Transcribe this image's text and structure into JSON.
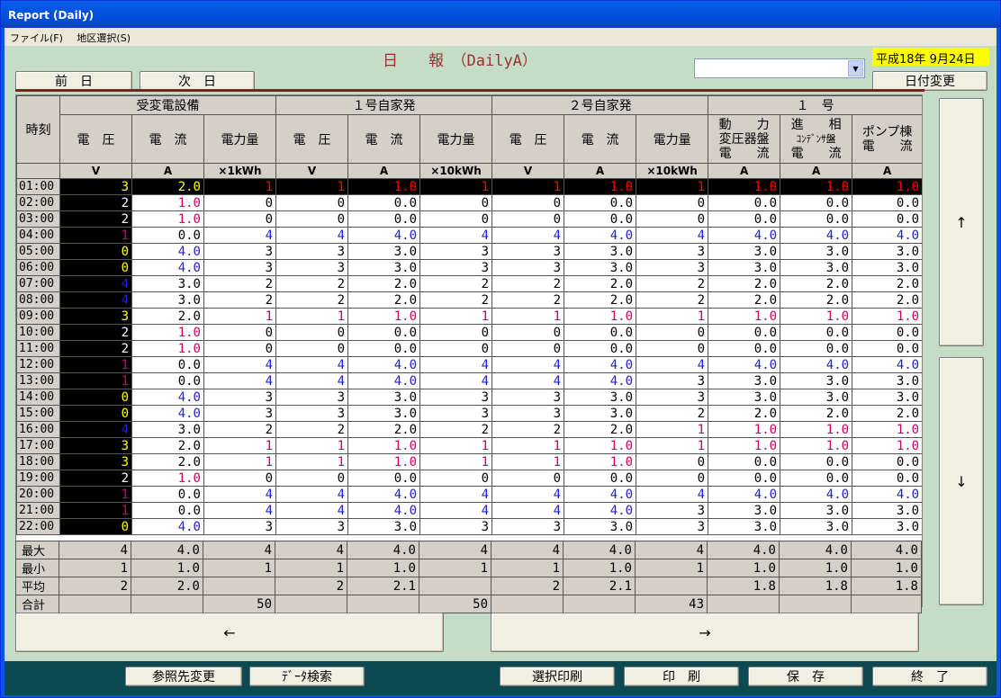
{
  "window": {
    "title": "Report (Daily)"
  },
  "menu": [
    "ファイル(F)",
    "地区選択(S)"
  ],
  "page_title": "日　　報　（DailyA）",
  "date_display": "平成18年 9月24日",
  "buttons": {
    "prev_day": "前　日",
    "next_day": "次　日",
    "change_date": "日付変更",
    "scroll_up": "↑",
    "scroll_down": "↓",
    "scroll_left": "←",
    "scroll_right": "→",
    "change_ref": "参照先変更",
    "data_search": "ﾃﾞｰﾀ検索",
    "select_print": "選択印刷",
    "print": "印　刷",
    "save": "保　存",
    "exit": "終　了"
  },
  "colors": {
    "yellow": "#ffff00",
    "magenta": "#cc0066",
    "blue": "#2222cc",
    "black": "#000000",
    "red": "#ff0000",
    "white": "#ffffff"
  },
  "table": {
    "time_header": "時刻",
    "groups": [
      "受変電設備",
      "１号自家発",
      "２号自家発",
      "１　号"
    ],
    "subheaders": [
      "電　圧",
      "電　流",
      "電力量",
      "電　圧",
      "電　流",
      "電力量",
      "電　圧",
      "電　流",
      "電力量"
    ],
    "extra_headers": [
      {
        "l1": "動　　力",
        "l2": "変圧器盤",
        "l3": "電　　流"
      },
      {
        "l1": "進　　相",
        "l2": "ｺﾝﾃﾞﾝｻ盤",
        "l3": "電　　流"
      },
      {
        "l1": "ポンプ棟",
        "l2": "",
        "l3": "電　　流"
      }
    ],
    "units": [
      "V",
      "A",
      "×1kWh",
      "V",
      "A",
      "×10kWh",
      "V",
      "A",
      "×10kWh",
      "A",
      "A",
      "A"
    ],
    "rows": [
      {
        "time": "01:00",
        "selected": true,
        "values": [
          "3",
          "2.0",
          "1",
          "1",
          "1.0",
          "1",
          "1",
          "1.0",
          "1",
          "1.0",
          "1.0",
          "1.0"
        ],
        "colors": [
          "yellow",
          "yellow",
          "red",
          "red",
          "red",
          "red",
          "red",
          "red",
          "red",
          "red",
          "red",
          "red"
        ]
      },
      {
        "time": "02:00",
        "values": [
          "2",
          "1.0",
          "0",
          "0",
          "0.0",
          "0",
          "0",
          "0.0",
          "0",
          "0.0",
          "0.0",
          "0.0"
        ],
        "colors": [
          "white",
          "magenta",
          "black",
          "black",
          "black",
          "black",
          "black",
          "black",
          "black",
          "black",
          "black",
          "black"
        ]
      },
      {
        "time": "03:00",
        "values": [
          "2",
          "1.0",
          "0",
          "0",
          "0.0",
          "0",
          "0",
          "0.0",
          "0",
          "0.0",
          "0.0",
          "0.0"
        ],
        "colors": [
          "white",
          "magenta",
          "black",
          "black",
          "black",
          "black",
          "black",
          "black",
          "black",
          "black",
          "black",
          "black"
        ]
      },
      {
        "time": "04:00",
        "values": [
          "1",
          "0.0",
          "4",
          "4",
          "4.0",
          "4",
          "4",
          "4.0",
          "4",
          "4.0",
          "4.0",
          "4.0"
        ],
        "colors": [
          "magenta",
          "black",
          "blue",
          "blue",
          "blue",
          "blue",
          "blue",
          "blue",
          "blue",
          "blue",
          "blue",
          "blue"
        ]
      },
      {
        "time": "05:00",
        "values": [
          "0",
          "4.0",
          "3",
          "3",
          "3.0",
          "3",
          "3",
          "3.0",
          "3",
          "3.0",
          "3.0",
          "3.0"
        ],
        "colors": [
          "yellow",
          "blue",
          "black",
          "black",
          "black",
          "black",
          "black",
          "black",
          "black",
          "black",
          "black",
          "black"
        ]
      },
      {
        "time": "06:00",
        "values": [
          "0",
          "4.0",
          "3",
          "3",
          "3.0",
          "3",
          "3",
          "3.0",
          "3",
          "3.0",
          "3.0",
          "3.0"
        ],
        "colors": [
          "yellow",
          "blue",
          "black",
          "black",
          "black",
          "black",
          "black",
          "black",
          "black",
          "black",
          "black",
          "black"
        ]
      },
      {
        "time": "07:00",
        "values": [
          "4",
          "3.0",
          "2",
          "2",
          "2.0",
          "2",
          "2",
          "2.0",
          "2",
          "2.0",
          "2.0",
          "2.0"
        ],
        "colors": [
          "blue",
          "black",
          "black",
          "black",
          "black",
          "black",
          "black",
          "black",
          "black",
          "black",
          "black",
          "black"
        ]
      },
      {
        "time": "08:00",
        "values": [
          "4",
          "3.0",
          "2",
          "2",
          "2.0",
          "2",
          "2",
          "2.0",
          "2",
          "2.0",
          "2.0",
          "2.0"
        ],
        "colors": [
          "blue",
          "black",
          "black",
          "black",
          "black",
          "black",
          "black",
          "black",
          "black",
          "black",
          "black",
          "black"
        ]
      },
      {
        "time": "09:00",
        "values": [
          "3",
          "2.0",
          "1",
          "1",
          "1.0",
          "1",
          "1",
          "1.0",
          "1",
          "1.0",
          "1.0",
          "1.0"
        ],
        "colors": [
          "yellow",
          "black",
          "magenta",
          "magenta",
          "magenta",
          "magenta",
          "magenta",
          "magenta",
          "magenta",
          "magenta",
          "magenta",
          "magenta"
        ]
      },
      {
        "time": "10:00",
        "values": [
          "2",
          "1.0",
          "0",
          "0",
          "0.0",
          "0",
          "0",
          "0.0",
          "0",
          "0.0",
          "0.0",
          "0.0"
        ],
        "colors": [
          "white",
          "magenta",
          "black",
          "black",
          "black",
          "black",
          "black",
          "black",
          "black",
          "black",
          "black",
          "black"
        ]
      },
      {
        "time": "11:00",
        "values": [
          "2",
          "1.0",
          "0",
          "0",
          "0.0",
          "0",
          "0",
          "0.0",
          "0",
          "0.0",
          "0.0",
          "0.0"
        ],
        "colors": [
          "white",
          "magenta",
          "black",
          "black",
          "black",
          "black",
          "black",
          "black",
          "black",
          "black",
          "black",
          "black"
        ]
      },
      {
        "time": "12:00",
        "values": [
          "1",
          "0.0",
          "4",
          "4",
          "4.0",
          "4",
          "4",
          "4.0",
          "4",
          "4.0",
          "4.0",
          "4.0"
        ],
        "colors": [
          "magenta",
          "black",
          "blue",
          "blue",
          "blue",
          "blue",
          "blue",
          "blue",
          "blue",
          "blue",
          "blue",
          "blue"
        ]
      },
      {
        "time": "13:00",
        "values": [
          "1",
          "0.0",
          "4",
          "4",
          "4.0",
          "4",
          "4",
          "4.0",
          "3",
          "3.0",
          "3.0",
          "3.0"
        ],
        "colors": [
          "magenta",
          "black",
          "blue",
          "blue",
          "blue",
          "blue",
          "blue",
          "blue",
          "black",
          "black",
          "black",
          "black"
        ]
      },
      {
        "time": "14:00",
        "values": [
          "0",
          "4.0",
          "3",
          "3",
          "3.0",
          "3",
          "3",
          "3.0",
          "3",
          "3.0",
          "3.0",
          "3.0"
        ],
        "colors": [
          "yellow",
          "blue",
          "black",
          "black",
          "black",
          "black",
          "black",
          "black",
          "black",
          "black",
          "black",
          "black"
        ]
      },
      {
        "time": "15:00",
        "values": [
          "0",
          "4.0",
          "3",
          "3",
          "3.0",
          "3",
          "3",
          "3.0",
          "2",
          "2.0",
          "2.0",
          "2.0"
        ],
        "colors": [
          "yellow",
          "blue",
          "black",
          "black",
          "black",
          "black",
          "black",
          "black",
          "black",
          "black",
          "black",
          "black"
        ]
      },
      {
        "time": "16:00",
        "values": [
          "4",
          "3.0",
          "2",
          "2",
          "2.0",
          "2",
          "2",
          "2.0",
          "1",
          "1.0",
          "1.0",
          "1.0"
        ],
        "colors": [
          "blue",
          "black",
          "black",
          "black",
          "black",
          "black",
          "black",
          "black",
          "magenta",
          "magenta",
          "magenta",
          "magenta"
        ]
      },
      {
        "time": "17:00",
        "values": [
          "3",
          "2.0",
          "1",
          "1",
          "1.0",
          "1",
          "1",
          "1.0",
          "1",
          "1.0",
          "1.0",
          "1.0"
        ],
        "colors": [
          "yellow",
          "black",
          "magenta",
          "magenta",
          "magenta",
          "magenta",
          "magenta",
          "magenta",
          "magenta",
          "magenta",
          "magenta",
          "magenta"
        ]
      },
      {
        "time": "18:00",
        "values": [
          "3",
          "2.0",
          "1",
          "1",
          "1.0",
          "1",
          "1",
          "1.0",
          "0",
          "0.0",
          "0.0",
          "0.0"
        ],
        "colors": [
          "yellow",
          "black",
          "magenta",
          "magenta",
          "magenta",
          "magenta",
          "magenta",
          "magenta",
          "black",
          "black",
          "black",
          "black"
        ]
      },
      {
        "time": "19:00",
        "values": [
          "2",
          "1.0",
          "0",
          "0",
          "0.0",
          "0",
          "0",
          "0.0",
          "0",
          "0.0",
          "0.0",
          "0.0"
        ],
        "colors": [
          "white",
          "magenta",
          "black",
          "black",
          "black",
          "black",
          "black",
          "black",
          "black",
          "black",
          "black",
          "black"
        ]
      },
      {
        "time": "20:00",
        "values": [
          "1",
          "0.0",
          "4",
          "4",
          "4.0",
          "4",
          "4",
          "4.0",
          "4",
          "4.0",
          "4.0",
          "4.0"
        ],
        "colors": [
          "magenta",
          "black",
          "blue",
          "blue",
          "blue",
          "blue",
          "blue",
          "blue",
          "blue",
          "blue",
          "blue",
          "blue"
        ]
      },
      {
        "time": "21:00",
        "values": [
          "1",
          "0.0",
          "4",
          "4",
          "4.0",
          "4",
          "4",
          "4.0",
          "3",
          "3.0",
          "3.0",
          "3.0"
        ],
        "colors": [
          "magenta",
          "black",
          "blue",
          "blue",
          "blue",
          "blue",
          "blue",
          "blue",
          "black",
          "black",
          "black",
          "black"
        ]
      },
      {
        "time": "22:00",
        "values": [
          "0",
          "4.0",
          "3",
          "3",
          "3.0",
          "3",
          "3",
          "3.0",
          "3",
          "3.0",
          "3.0",
          "3.0"
        ],
        "colors": [
          "yellow",
          "blue",
          "black",
          "black",
          "black",
          "black",
          "black",
          "black",
          "black",
          "black",
          "black",
          "black"
        ]
      }
    ],
    "summary": [
      {
        "label": "最大",
        "values": [
          "4",
          "4.0",
          "4",
          "4",
          "4.0",
          "4",
          "4",
          "4.0",
          "4",
          "4.0",
          "4.0",
          "4.0"
        ]
      },
      {
        "label": "最小",
        "values": [
          "1",
          "1.0",
          "1",
          "1",
          "1.0",
          "1",
          "1",
          "1.0",
          "1",
          "1.0",
          "1.0",
          "1.0"
        ]
      },
      {
        "label": "平均",
        "values": [
          "2",
          "2.0",
          "",
          "2",
          "2.1",
          "",
          "2",
          "2.1",
          "",
          "1.8",
          "1.8",
          "1.8"
        ]
      },
      {
        "label": "合計",
        "values": [
          "",
          "",
          "50",
          "",
          "",
          "50",
          "",
          "",
          "43",
          "",
          "",
          ""
        ]
      }
    ]
  }
}
